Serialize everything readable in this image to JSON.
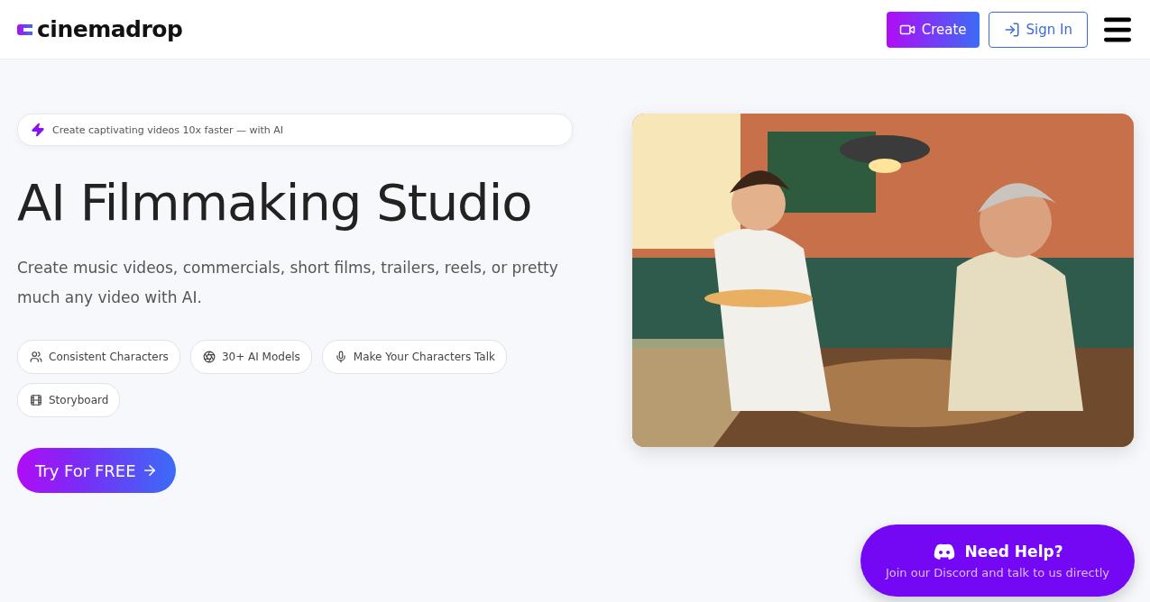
{
  "header": {
    "logo": "cinemadrop",
    "create_button": "Create",
    "sign_in_button": "Sign In"
  },
  "hero": {
    "tagline": "Create captivating videos 10x faster — with AI",
    "title": "AI Filmmaking Studio",
    "subtitle": "Create music videos, commercials, short films, trailers, reels, or pretty much any video with AI.",
    "features": [
      {
        "kind": "characters",
        "label": "Consistent Characters"
      },
      {
        "kind": "models",
        "label": "30+ AI Models"
      },
      {
        "kind": "talk",
        "label": "Make Your Characters Talk"
      },
      {
        "kind": "storyboard",
        "label": "Storyboard"
      }
    ],
    "cta": "Try For FREE"
  },
  "help": {
    "title": "Need Help?",
    "subtitle": "Join our Discord and talk to us directly"
  }
}
